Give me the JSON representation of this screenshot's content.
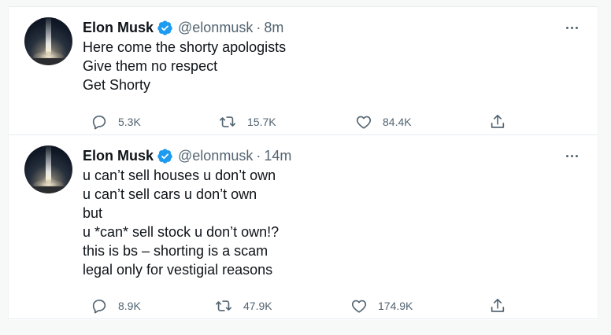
{
  "tweets": [
    {
      "author": {
        "name": "Elon Musk",
        "handle": "@elonmusk",
        "verified_icon": "verified-badge-icon"
      },
      "separator": "·",
      "time": "8m",
      "lines": [
        "Here come the shorty apologists",
        "Give them no respect",
        "Get Shorty"
      ],
      "replies": "5.3K",
      "retweets": "15.7K",
      "likes": "84.4K"
    },
    {
      "author": {
        "name": "Elon Musk",
        "handle": "@elonmusk",
        "verified_icon": "verified-badge-icon"
      },
      "separator": "·",
      "time": "14m",
      "lines": [
        "u can’t sell houses u don’t own",
        "u can’t sell cars u don’t own",
        "but",
        "u *can* sell stock u don’t own!?",
        "this is bs – shorting is a scam",
        "legal only for vestigial reasons"
      ],
      "replies": "8.9K",
      "retweets": "47.9K",
      "likes": "174.9K"
    }
  ],
  "colors": {
    "verified": "#1d9bf0",
    "secondary_text": "#536471",
    "primary_text": "#0f1419",
    "divider": "#e6ecf0",
    "background": "#f7f9f9"
  },
  "icons": [
    "avatar",
    "verified-badge-icon",
    "more-icon",
    "reply-icon",
    "retweet-icon",
    "like-icon",
    "share-icon"
  ]
}
